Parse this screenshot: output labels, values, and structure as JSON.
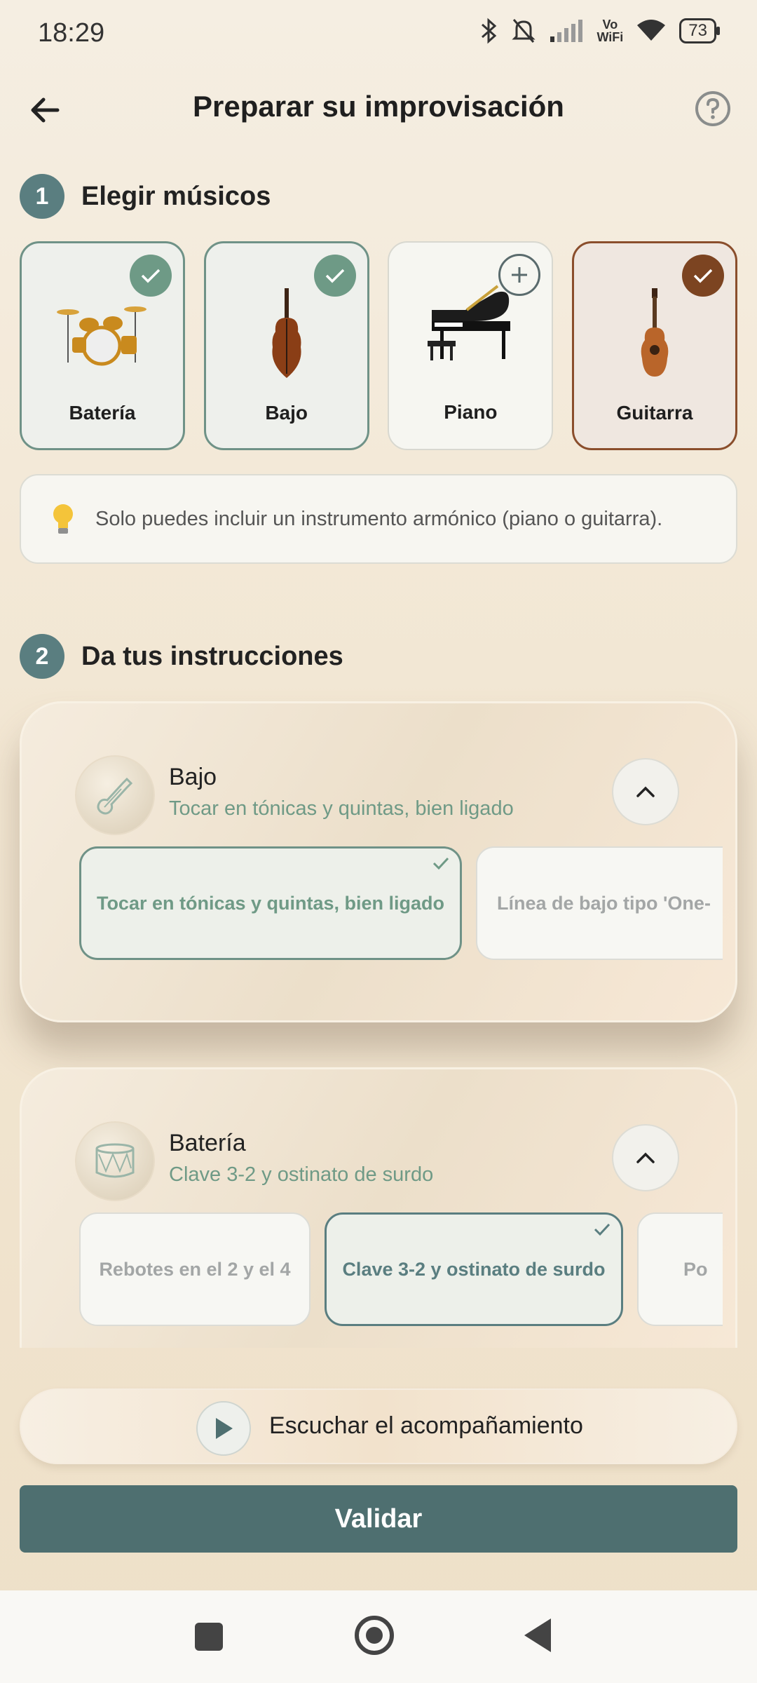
{
  "status_bar": {
    "time": "18:29",
    "battery": "73",
    "vowifi_top": "Vo",
    "vowifi_bottom": "WiFi"
  },
  "header": {
    "title": "Preparar su improvisación"
  },
  "section1": {
    "number": "1",
    "title": "Elegir músicos",
    "instruments": [
      {
        "label": "Batería",
        "state": "selected"
      },
      {
        "label": "Bajo",
        "state": "selected"
      },
      {
        "label": "Piano",
        "state": "add"
      },
      {
        "label": "Guitarra",
        "state": "selected"
      }
    ],
    "tip": "Solo puedes incluir un instrumento armónico (piano o guitarra)."
  },
  "section2": {
    "number": "2",
    "title": "Da tus instrucciones",
    "panels": [
      {
        "name": "Bajo",
        "subtitle": "Tocar en tónicas y quintas, bien ligado",
        "options": [
          "Tocar en tónicas y quintas, bien ligado",
          "Línea de bajo tipo 'One-"
        ],
        "selected_index": 0
      },
      {
        "name": "Batería",
        "subtitle": "Clave 3-2 y ostinato de surdo",
        "options": [
          "Rebotes en el 2 y el 4",
          "Clave 3-2 y ostinato de surdo",
          "Po"
        ],
        "selected_index": 1
      }
    ]
  },
  "actions": {
    "listen": "Escuchar el acompañamiento",
    "validate": "Validar"
  },
  "colors": {
    "accent_teal": "#5a7e80",
    "accent_green": "#6e9a86",
    "accent_brown": "#7c4421",
    "button": "#4e6f70"
  }
}
